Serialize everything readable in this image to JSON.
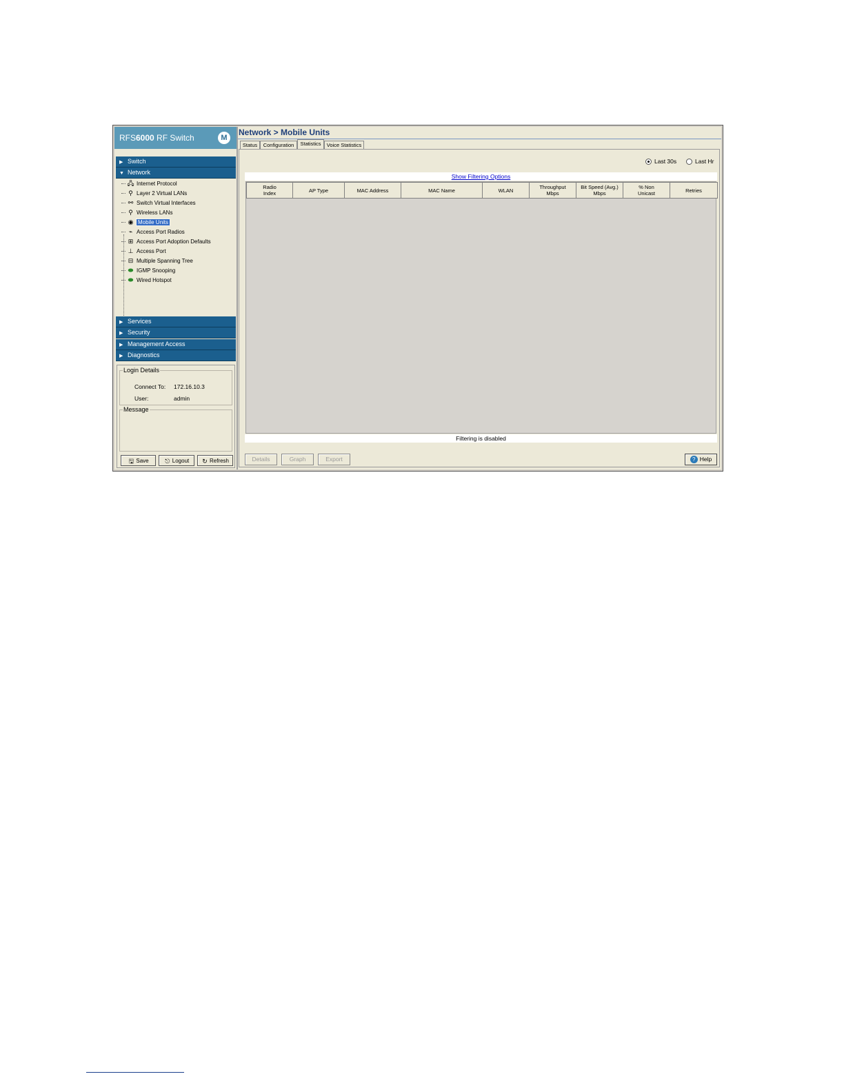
{
  "app": {
    "brand_pre": "RFS",
    "brand_bold": "6000",
    "brand_post": " RF Switch",
    "logo_glyph": "M"
  },
  "sidebar": {
    "sections_top": [
      {
        "label": "Switch",
        "expanded": false
      },
      {
        "label": "Network",
        "expanded": true
      }
    ],
    "tree_items": [
      {
        "label": "Internet Protocol",
        "icon": "network-icon"
      },
      {
        "label": "Layer 2 Virtual LANs",
        "icon": "vlan-icon"
      },
      {
        "label": "Switch Virtual Interfaces",
        "icon": "interface-icon"
      },
      {
        "label": "Wireless LANs",
        "icon": "wlan-icon"
      },
      {
        "label": "Mobile Units",
        "icon": "mobile-unit-icon",
        "selected": true
      },
      {
        "label": "Access Port Radios",
        "icon": "radio-icon"
      },
      {
        "label": "Access Port Adoption Defaults",
        "icon": "adoption-icon"
      },
      {
        "label": "Access Port",
        "icon": "access-port-icon"
      },
      {
        "label": "Multiple Spanning Tree",
        "icon": "spanning-tree-icon"
      },
      {
        "label": "IGMP Snooping",
        "icon": "igmp-icon"
      },
      {
        "label": "Wired Hotspot",
        "icon": "hotspot-icon"
      }
    ],
    "sections_bottom": [
      {
        "label": "Services"
      },
      {
        "label": "Security"
      },
      {
        "label": "Management Access"
      },
      {
        "label": "Diagnostics"
      }
    ],
    "login": {
      "legend": "Login Details",
      "connect_label": "Connect To:",
      "connect_value": "172.16.10.3",
      "user_label": "User:",
      "user_value": "admin"
    },
    "message": {
      "legend": "Message"
    },
    "buttons": {
      "save": "Save",
      "logout": "Logout",
      "refresh": "Refresh"
    }
  },
  "main": {
    "breadcrumb": "Network > Mobile Units",
    "tabs": [
      {
        "label": "Status"
      },
      {
        "label": "Configuration"
      },
      {
        "label": "Statistics",
        "active": true
      },
      {
        "label": "Voice Statistics"
      }
    ],
    "interval": {
      "options": [
        {
          "label": "Last 30s",
          "selected": true
        },
        {
          "label": "Last Hr",
          "selected": false
        }
      ]
    },
    "filter_link": "Show Filtering Options",
    "table": {
      "columns": [
        [
          "Radio",
          "Index"
        ],
        [
          "AP Type"
        ],
        [
          "MAC Address"
        ],
        [
          "MAC Name"
        ],
        [
          "WLAN"
        ],
        [
          "Throughput",
          "Mbps"
        ],
        [
          "Bit Speed (Avg.)",
          "Mbps"
        ],
        [
          "% Non",
          "Unicast"
        ],
        [
          "Retries"
        ]
      ],
      "rows": []
    },
    "filter_status": "Filtering is disabled",
    "buttons": {
      "details": "Details",
      "graph": "Graph",
      "export": "Export",
      "help": "Help"
    }
  },
  "colors": {
    "section_bar": "#1b5f8e",
    "brand_bar": "#5b9ab8",
    "title": "#1f3f7a",
    "selection": "#316ac5"
  }
}
